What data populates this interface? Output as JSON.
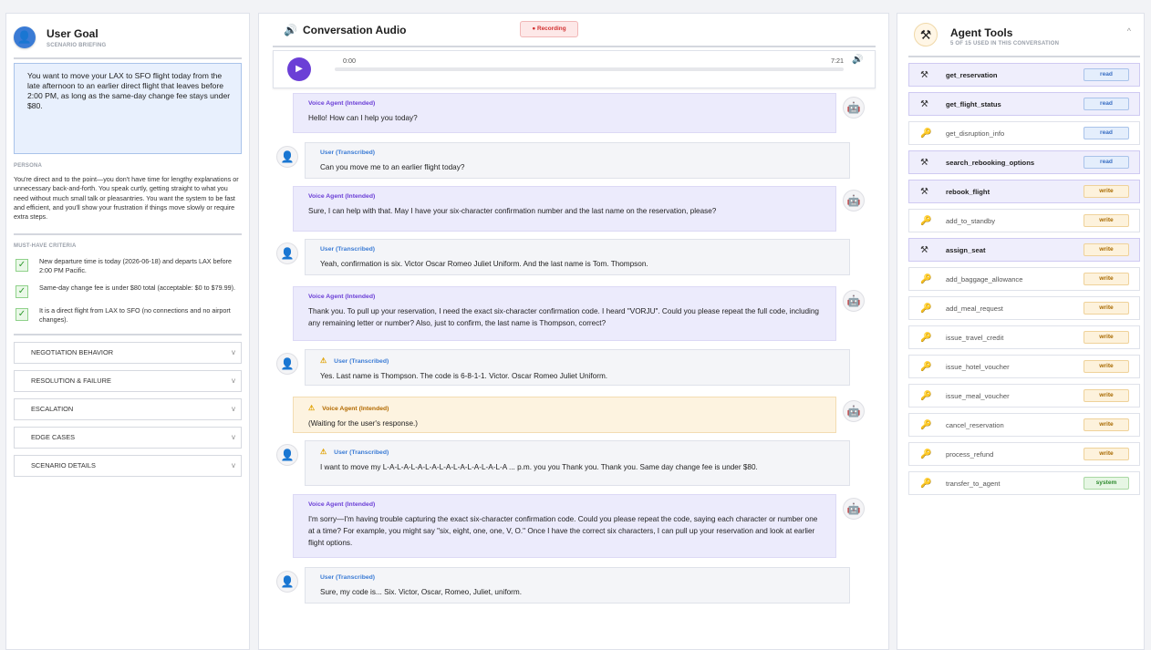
{
  "goal": {
    "title": "User Goal",
    "subtitle": "SCENARIO BRIEFING",
    "text": "You want to move your LAX to SFO flight today from the late afternoon to an earlier direct flight that leaves before 2:00 PM, as long as the same-day change fee stays under $80.",
    "persona_heading": "PERSONA",
    "persona_text": "You're direct and to the point—you don't have time for lengthy explanations or unnecessary back-and-forth. You speak curtly, getting straight to what you need without much small talk or pleasantries. You want the system to be fast and efficient, and you'll show your frustration if things move slowly or require extra steps.",
    "criteria_heading": "MUST-HAVE CRITERIA",
    "criteria": [
      "New departure time is today (2026-06-18) and departs LAX before 2:00 PM Pacific.",
      "Same-day change fee is under $80 total (acceptable: $0 to $79.99).",
      "It is a direct flight from LAX to SFO (no connections and no airport changes)."
    ],
    "check_glyph": "✓",
    "sections": [
      "NEGOTIATION BEHAVIOR",
      "RESOLUTION & FAILURE",
      "ESCALATION",
      "EDGE CASES",
      "SCENARIO DETAILS"
    ],
    "section_chevron": "v"
  },
  "conversation": {
    "title": "Conversation Audio",
    "recording_label": "● Recording",
    "time_current": "0:00",
    "time_total": "7:21",
    "progress": 0,
    "messages": [
      {
        "role": "Voice Agent (Intended)",
        "text": "Hello! How can I help you today?"
      },
      {
        "role": "User (Transcribed)",
        "text": "Can you move me to an earlier flight today?"
      },
      {
        "role": "Voice Agent (Intended)",
        "text": "Sure, I can help with that. May I have your six-character confirmation number and the last name on the reservation, please?"
      },
      {
        "role": "User (Transcribed)",
        "text": "Yeah, confirmation is six. Victor Oscar Romeo Juliet Uniform. And the last name is Tom. Thompson."
      },
      {
        "role": "Voice Agent (Intended)",
        "text": "Thank you. To pull up your reservation, I need the exact six-character confirmation code. I heard \"VORJU\". Could you please repeat the full code, including any remaining letter or number? Also, just to confirm, the last name is Thompson, correct?"
      },
      {
        "role": "User (Transcribed)",
        "text": "Yes. Last name is Thompson. The code is 6-8-1-1. Victor. Oscar Romeo Juliet Uniform."
      },
      {
        "role": "Voice Agent (Intended)",
        "text": "(Waiting for the user's response.)"
      },
      {
        "role": "User (Transcribed)",
        "text": "I want to move my L-A-L-A-L-A-L-A-L-A-L-A-L-A-L-A-L-A ... p.m. you you Thank you. Thank you. Same day change fee is under $80."
      },
      {
        "role": "Voice Agent (Intended)",
        "text": "I'm sorry—I'm having trouble capturing the exact six-character confirmation code. Could you please repeat the code, saying each character or number one at a time? For example, you might say \"six, eight, one, one, V, O.\" Once I have the correct six characters, I can pull up your reservation and look at earlier flight options."
      },
      {
        "role": "User (Transcribed)",
        "text": "Sure, my code is... Six. Victor, Oscar, Romeo, Juliet, uniform."
      }
    ]
  },
  "tools": {
    "title": "Agent Tools",
    "subtitle": "5 OF 15 USED IN THIS CONVERSATION",
    "collapse_glyph": "^",
    "items": [
      {
        "name": "get_reservation",
        "type": "read",
        "used": true
      },
      {
        "name": "get_flight_status",
        "type": "read",
        "used": true
      },
      {
        "name": "get_disruption_info",
        "type": "read",
        "used": false
      },
      {
        "name": "search_rebooking_options",
        "type": "read",
        "used": true
      },
      {
        "name": "rebook_flight",
        "type": "write",
        "used": true
      },
      {
        "name": "add_to_standby",
        "type": "write",
        "used": false
      },
      {
        "name": "assign_seat",
        "type": "write",
        "used": true
      },
      {
        "name": "add_baggage_allowance",
        "type": "write",
        "used": false
      },
      {
        "name": "add_meal_request",
        "type": "write",
        "used": false
      },
      {
        "name": "issue_travel_credit",
        "type": "write",
        "used": false
      },
      {
        "name": "issue_hotel_voucher",
        "type": "write",
        "used": false
      },
      {
        "name": "issue_meal_voucher",
        "type": "write",
        "used": false
      },
      {
        "name": "cancel_reservation",
        "type": "write",
        "used": false
      },
      {
        "name": "process_refund",
        "type": "write",
        "used": false
      },
      {
        "name": "transfer_to_agent",
        "type": "system",
        "used": false
      }
    ]
  }
}
